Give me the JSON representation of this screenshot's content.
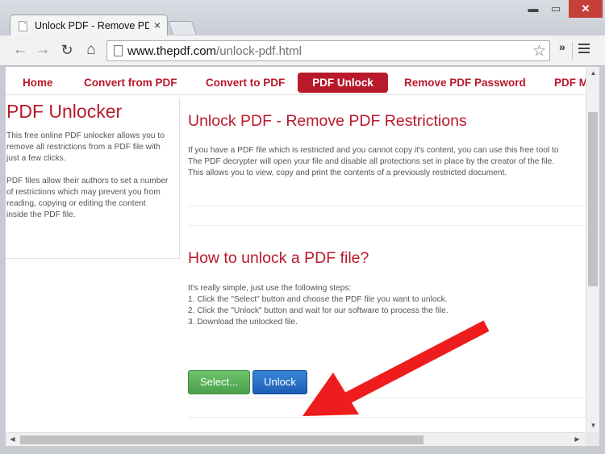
{
  "browser": {
    "tab_title": "Unlock PDF - Remove PDF",
    "tab_close": "×",
    "url_host": "www.thepdf.com",
    "url_path": "/unlock-pdf.html",
    "icons": {
      "back": "arrow-left",
      "forward": "arrow-right",
      "reload": "reload",
      "home": "home",
      "star": "star",
      "extensions": "double-chevron",
      "menu": "hamburger"
    },
    "window_controls": {
      "minimize": "▬",
      "maximize": "▭",
      "close": "✕"
    },
    "close_color": "#c6403a"
  },
  "nav": {
    "items": [
      {
        "label": "Home"
      },
      {
        "label": "Convert from PDF"
      },
      {
        "label": "Convert to PDF"
      },
      {
        "label": "PDF Unlock",
        "active": true
      },
      {
        "label": "Remove PDF Password"
      },
      {
        "label": "PDF M"
      }
    ],
    "accent": "#b8192b"
  },
  "sidebar": {
    "title": "PDF Unlocker",
    "para1": [
      "This free online PDF unlocker allows you to",
      "remove all restrictions from a PDF file with",
      "just a few clicks."
    ],
    "para2": [
      "PDF files allow their authors to set a number",
      "of restrictions which may prevent you from",
      "reading, copying or editing the content",
      "inside the PDF file."
    ]
  },
  "main": {
    "heading1": "Unlock PDF - Remove PDF Restrictions",
    "intro": [
      "If you have a PDF file which is restricted and you cannot copy it's content, you can use this free tool to",
      "The PDF decrypter will open your file and disable all protections set in place by the creator of the file.",
      "This allows you to view, copy and print the contents of a previously restricted document."
    ],
    "heading2": "How to unlock a PDF file?",
    "steps": [
      "It's really simple, just use the following steps:",
      "1. Click the \"Select\" button and choose the PDF file you want to unlock.",
      "2. Click the \"Unlock\" button and wait for our software to process the file.",
      "3. Download the unlocked file."
    ],
    "select_button": "Select...",
    "unlock_button": "Unlock",
    "select_color": "#5cb85c",
    "unlock_color": "#2a6fc9"
  },
  "annotation": {
    "arrow_color": "#ee1c1c"
  }
}
